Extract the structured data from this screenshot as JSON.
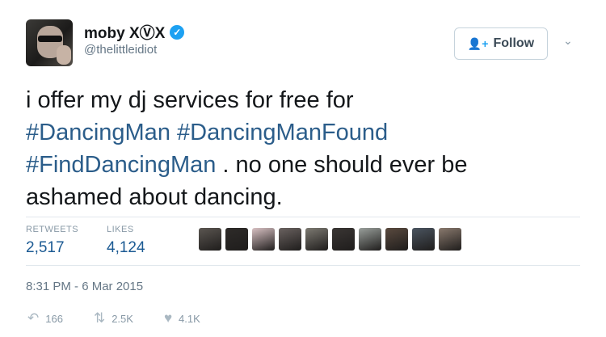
{
  "user": {
    "display_name": "moby XⓋX",
    "handle": "@thelittleidiot",
    "verified_icon": "verified-badge-icon"
  },
  "follow_button": {
    "label": "Follow",
    "icon": "add-person-icon"
  },
  "more_menu": {
    "icon": "chevron-down-icon"
  },
  "tweet": {
    "line1": "i offer my dj services for free for",
    "hashtag1": "#DancingMan",
    "hashtag2": "#DancingManFound",
    "hashtag3": "#FindDancingMan",
    "line3_rest": " . no one should ever be",
    "line4": "ashamed about dancing."
  },
  "stats": {
    "retweets_label": "RETWEETS",
    "retweets_value": "2,517",
    "likes_label": "LIKES",
    "likes_value": "4,124"
  },
  "likers": {
    "colors": [
      "#5b5651",
      "#2e2b29",
      "#d9c2c4",
      "#6a6260",
      "#7d7a72",
      "#3a3634",
      "#9aa09c",
      "#5a4a3f",
      "#4b5560",
      "#8a7a6e"
    ]
  },
  "timestamp": "8:31 PM - 6 Mar 2015",
  "actions": {
    "reply_count": "166",
    "retweet_count": "2.5K",
    "like_count": "4.1K"
  },
  "colors": {
    "link": "#2b5d8a",
    "verified": "#1da1f2",
    "muted": "#657786"
  }
}
